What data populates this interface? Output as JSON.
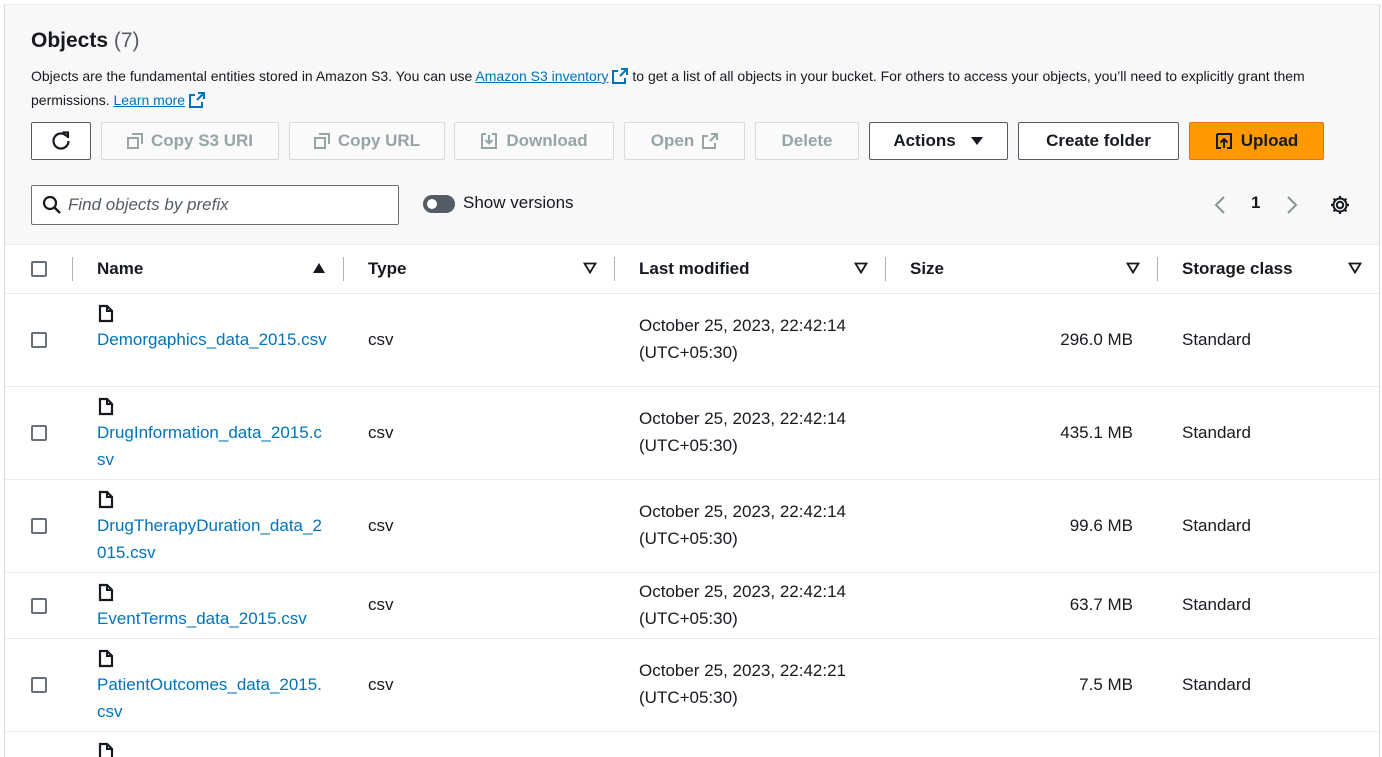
{
  "header": {
    "title": "Objects",
    "count": "(7)",
    "desc_before": "Objects are the fundamental entities stored in Amazon S3. You can use ",
    "inventory_link": "Amazon S3 inventory",
    "desc_after": " to get a list of all objects in your bucket. For others to access your objects, you’ll need to explicitly grant them permissions. ",
    "learn_more": "Learn more"
  },
  "toolbar": {
    "copy_s3_uri": "Copy S3 URI",
    "copy_url": "Copy URL",
    "download": "Download",
    "open": "Open",
    "delete": "Delete",
    "actions": "Actions",
    "create_folder": "Create folder",
    "upload": "Upload"
  },
  "filter": {
    "placeholder": "Find objects by prefix",
    "show_versions": "Show versions"
  },
  "pagination": {
    "page": "1"
  },
  "table": {
    "columns": {
      "name": "Name",
      "type": "Type",
      "last_modified": "Last modified",
      "size": "Size",
      "storage_class": "Storage class"
    },
    "rows": [
      {
        "name": "Demorgaphics_data_2015.csv",
        "type": "csv",
        "modified_line1": "October 25, 2023, 22:42:14",
        "modified_line2": "(UTC+05:30)",
        "size": "296.0 MB",
        "storage": "Standard"
      },
      {
        "name": "DrugInformation_data_2015.csv",
        "type": "csv",
        "modified_line1": "October 25, 2023, 22:42:14",
        "modified_line2": "(UTC+05:30)",
        "size": "435.1 MB",
        "storage": "Standard"
      },
      {
        "name": "DrugTherapyDuration_data_2015.csv",
        "type": "csv",
        "modified_line1": "October 25, 2023, 22:42:14",
        "modified_line2": "(UTC+05:30)",
        "size": "99.6 MB",
        "storage": "Standard"
      },
      {
        "name": "EventTerms_data_2015.csv",
        "type": "csv",
        "modified_line1": "October 25, 2023, 22:42:14",
        "modified_line2": "(UTC+05:30)",
        "size": "63.7 MB",
        "storage": "Standard"
      },
      {
        "name": "PatientOutcomes_data_2015.csv",
        "type": "csv",
        "modified_line1": "October 25, 2023, 22:42:21",
        "modified_line2": "(UTC+05:30)",
        "size": "7.5 MB",
        "storage": "Standard"
      }
    ]
  }
}
